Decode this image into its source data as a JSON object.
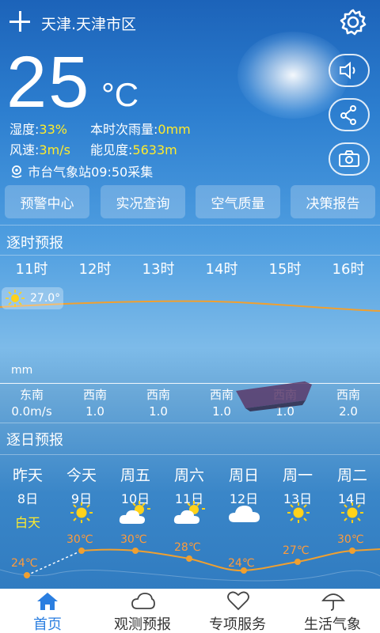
{
  "header": {
    "city": "天津.天津市区",
    "add_icon": "plus-icon",
    "settings_icon": "gear-icon"
  },
  "current": {
    "temperature": "25",
    "unit": "°C",
    "humidity_label": "湿度:",
    "humidity": "33%",
    "rain_label": "本时次雨量:",
    "rain": "0mm",
    "wind_label": "风速:",
    "wind": "3m/s",
    "visibility_label": "能见度:",
    "visibility": "5633m",
    "station": "市台气象站09:50采集"
  },
  "side_buttons": [
    "speaker-icon",
    "share-icon",
    "camera-icon"
  ],
  "quick_links": [
    "预警中心",
    "实况查询",
    "空气质量",
    "决策报告"
  ],
  "hourly": {
    "title": "逐时预报",
    "hours": [
      "11时",
      "12时",
      "13时",
      "14时",
      "15时",
      "16时"
    ],
    "temp_badge": "27.0°",
    "rain_unit": "mm",
    "wind_dirs": [
      "东南",
      "西南",
      "西南",
      "西南",
      "西南",
      "西南"
    ],
    "wind_speeds": [
      "0.0m/s",
      "1.0",
      "1.0",
      "1.0",
      "1.0",
      "2.0"
    ]
  },
  "daily": {
    "title": "逐日预报",
    "days": [
      {
        "name": "昨天",
        "date": "8日",
        "cond": "白天",
        "icon": "none"
      },
      {
        "name": "今天",
        "date": "9日",
        "cond": "",
        "icon": "sun-icon"
      },
      {
        "name": "周五",
        "date": "10日",
        "cond": "",
        "icon": "partly-cloudy-icon"
      },
      {
        "name": "周六",
        "date": "11日",
        "cond": "",
        "icon": "partly-cloudy-icon"
      },
      {
        "name": "周日",
        "date": "12日",
        "cond": "",
        "icon": "cloud-icon"
      },
      {
        "name": "周一",
        "date": "13日",
        "cond": "",
        "icon": "sun-icon"
      },
      {
        "name": "周二",
        "date": "14日",
        "cond": "",
        "icon": "sun-icon"
      }
    ],
    "highs": [
      "24℃",
      "30℃",
      "30℃",
      "28℃",
      "24℃",
      "27℃",
      "30℃"
    ]
  },
  "tabs": [
    {
      "label": "首页",
      "icon": "home-icon",
      "active": true
    },
    {
      "label": "观测预报",
      "icon": "cloud-icon",
      "active": false
    },
    {
      "label": "专项服务",
      "icon": "heart-icon",
      "active": false
    },
    {
      "label": "生活气象",
      "icon": "umbrella-icon",
      "active": false
    }
  ],
  "colors": {
    "accent_yellow": "#ffeb2b",
    "tab_active": "#2a7ee0",
    "curve": "#f0a030"
  }
}
